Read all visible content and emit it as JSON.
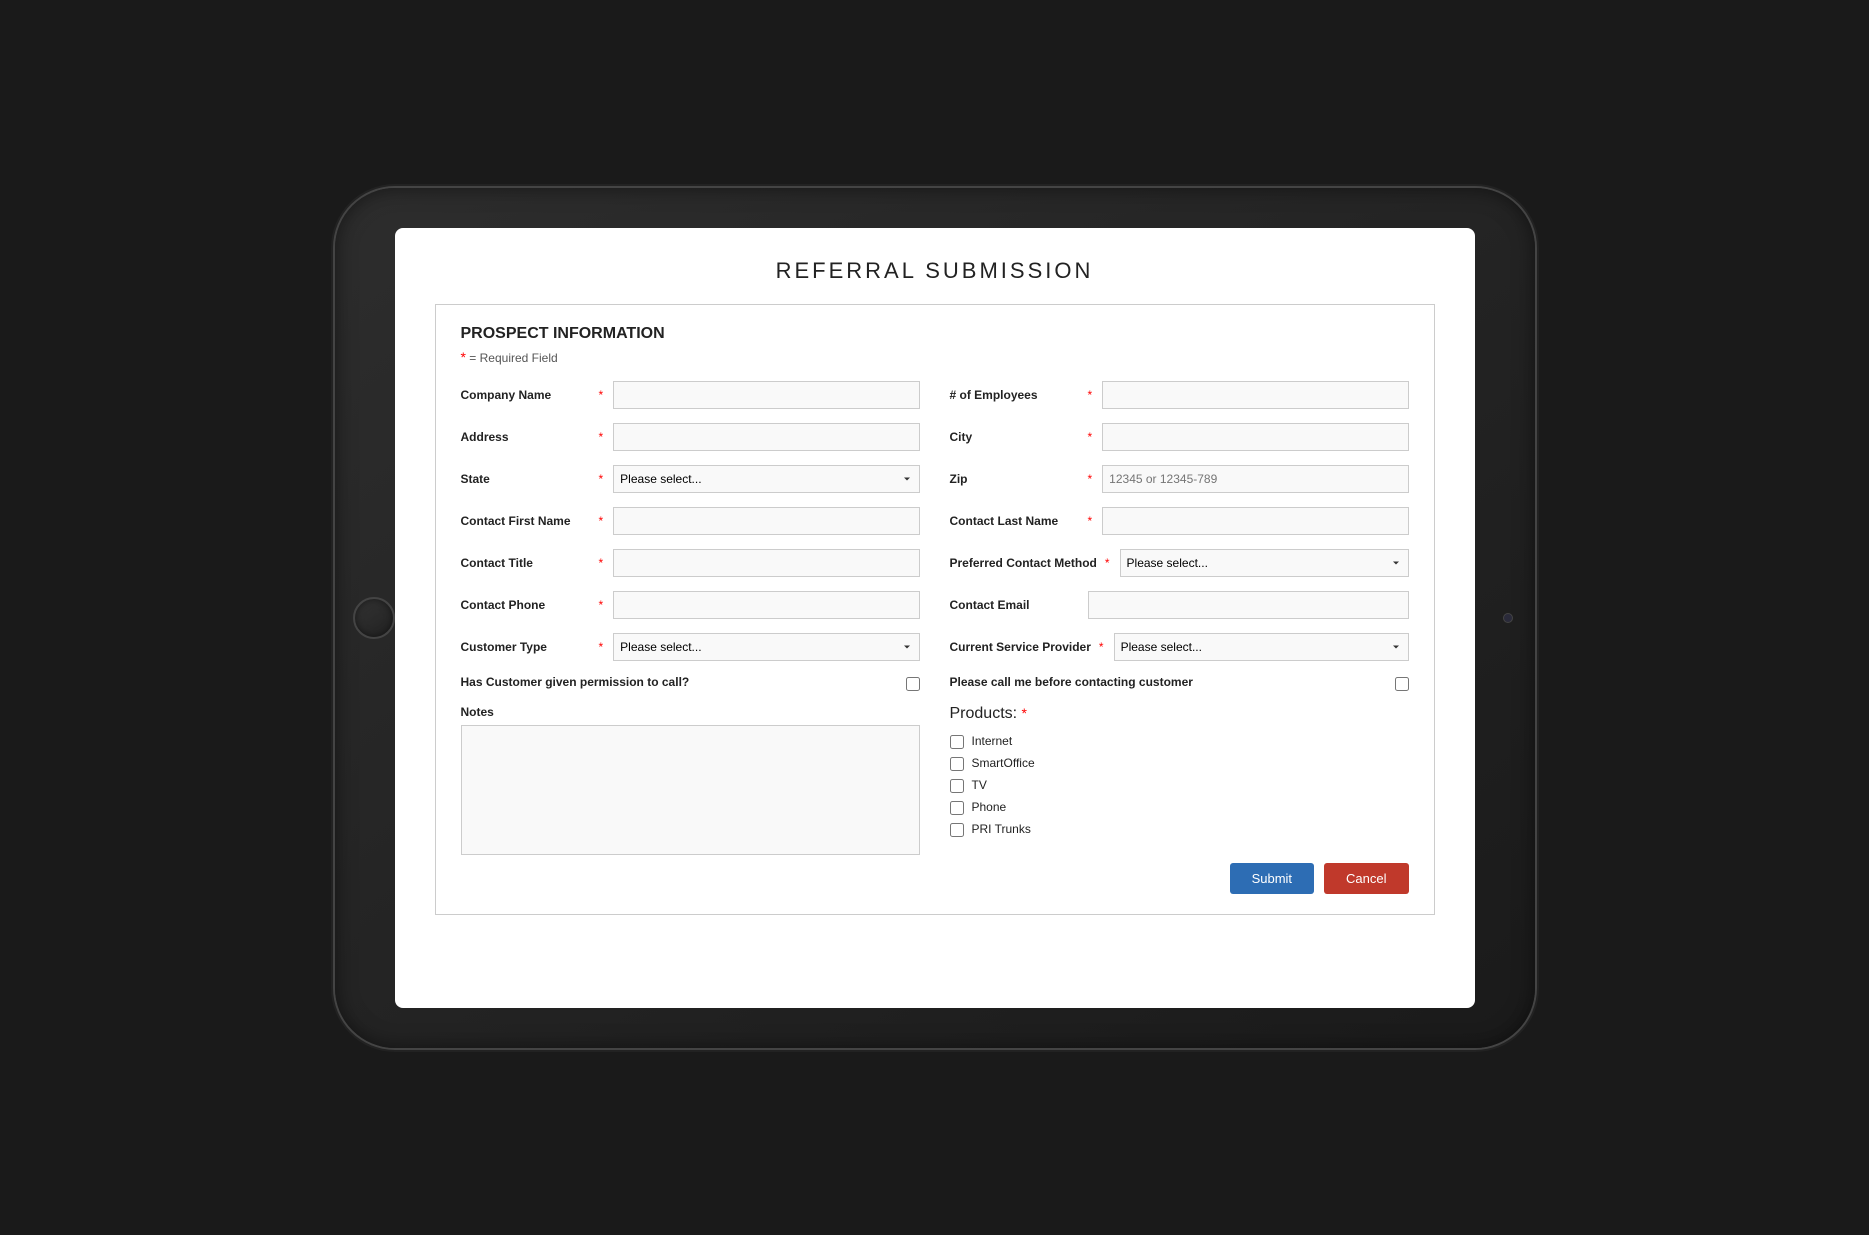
{
  "page": {
    "title": "REFERRAL SUBMISSION"
  },
  "form": {
    "section_title": "PROSPECT INFORMATION",
    "required_note": "= Required Field",
    "fields": {
      "company_name_label": "Company Name",
      "employees_label": "# of Employees",
      "address_label": "Address",
      "city_label": "City",
      "state_label": "State",
      "zip_label": "Zip",
      "zip_placeholder": "12345 or 12345-789",
      "contact_first_name_label": "Contact First Name",
      "contact_last_name_label": "Contact Last Name",
      "contact_title_label": "Contact Title",
      "preferred_contact_label": "Preferred Contact Method",
      "contact_phone_label": "Contact Phone",
      "contact_email_label": "Contact Email",
      "customer_type_label": "Customer Type",
      "current_provider_label": "Current Service Provider",
      "permission_label": "Has Customer given permission to call?",
      "call_before_label": "Please call me before contacting customer",
      "notes_label": "Notes",
      "products_label": "Products:",
      "select_placeholder": "Please select...",
      "products": [
        "Internet",
        "SmartOffice",
        "TV",
        "Phone",
        "PRI Trunks"
      ],
      "submit_label": "Submit",
      "cancel_label": "Cancel"
    }
  }
}
